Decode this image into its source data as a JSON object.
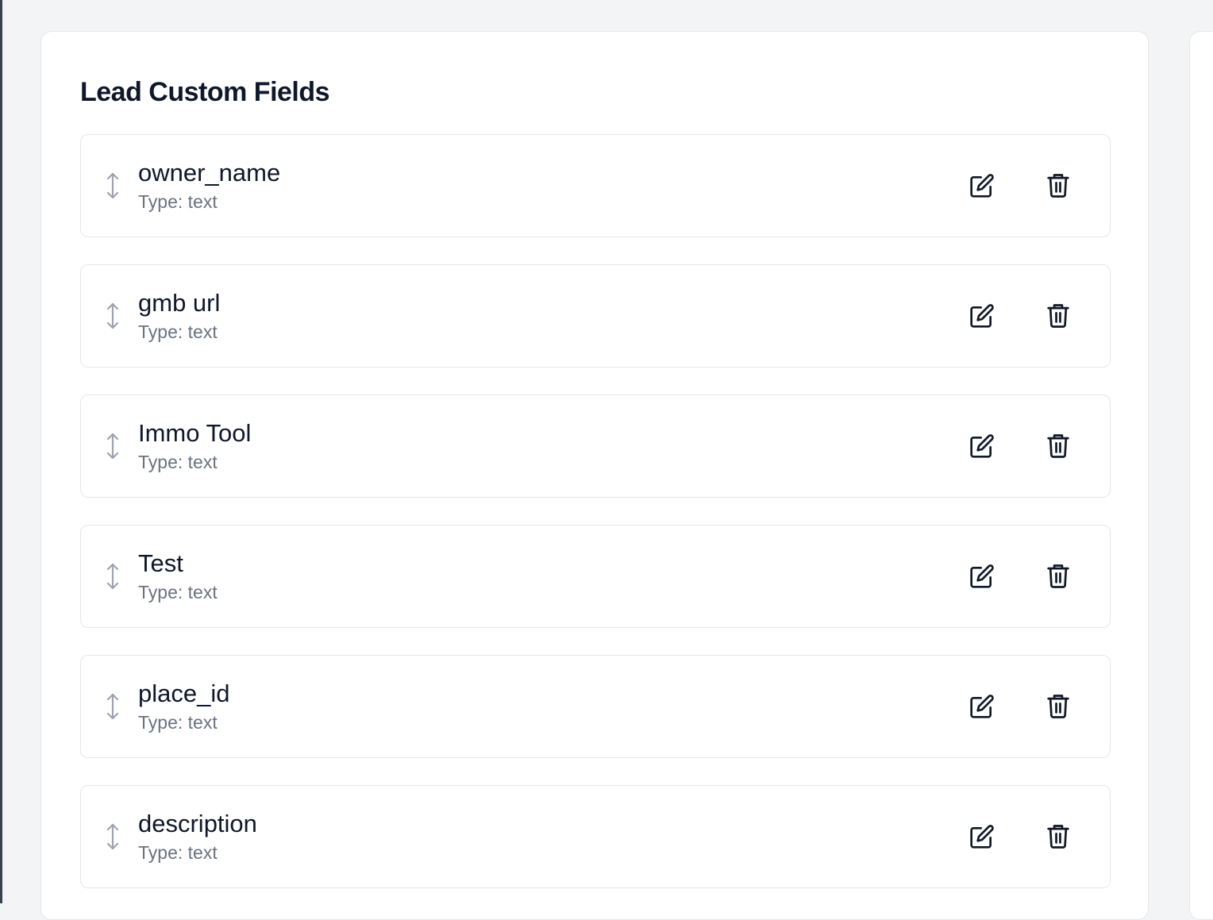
{
  "panel": {
    "title": "Lead Custom Fields"
  },
  "fields": [
    {
      "name": "owner_name",
      "type_label": "Type: text"
    },
    {
      "name": "gmb url",
      "type_label": "Type: text"
    },
    {
      "name": "Immo Tool",
      "type_label": "Type: text"
    },
    {
      "name": "Test",
      "type_label": "Type: text"
    },
    {
      "name": "place_id",
      "type_label": "Type: text"
    },
    {
      "name": "description",
      "type_label": "Type: text"
    }
  ],
  "icons": {
    "drag": "drag-handle-icon",
    "edit": "edit-icon",
    "delete": "trash-icon"
  },
  "colors": {
    "page_background": "#f3f4f6",
    "panel_background": "#ffffff",
    "border": "#e5e7eb",
    "title_text": "#0f172a",
    "secondary_text": "#6b7280",
    "drag_icon": "#9ca3af",
    "action_icon": "#111827"
  }
}
